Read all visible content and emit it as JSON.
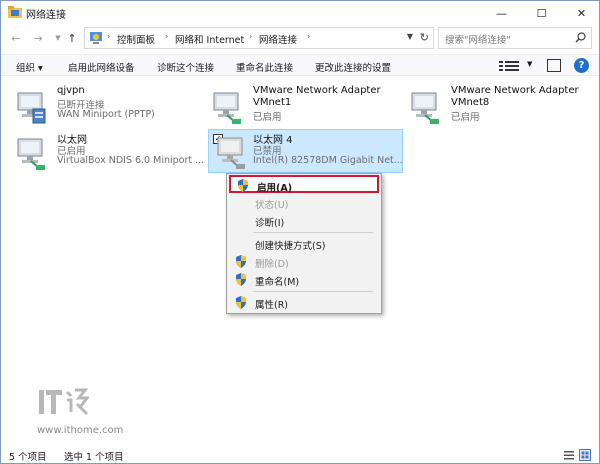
{
  "window": {
    "title": "网络连接",
    "min_glyph": "—",
    "max_glyph": "☐",
    "close_glyph": "✕"
  },
  "address": {
    "crumbs": [
      "控制面板",
      "网络和 Internet",
      "网络连接"
    ],
    "search_placeholder": "搜索\"网络连接\""
  },
  "commands": {
    "organize": "组织 ▾",
    "enable": "启用此网络设备",
    "diagnose": "诊断这个连接",
    "rename": "重命名此连接",
    "change": "更改此连接的设置",
    "help": "?"
  },
  "connections": [
    {
      "name": "qjvpn",
      "status": "已断开连接",
      "device": "WAN Miniport (PPTP)"
    },
    {
      "name": "VMware Network Adapter VMnet1",
      "name_line1": "VMware Network Adapter",
      "name_line2": "VMnet1",
      "status": "已启用",
      "device": ""
    },
    {
      "name": "VMware Network Adapter VMnet8",
      "name_line1": "VMware Network Adapter",
      "name_line2": "VMnet8",
      "status": "已启用",
      "device": ""
    },
    {
      "name": "以太网",
      "status": "已启用",
      "device": "VirtualBox NDIS 6.0 Miniport ..."
    },
    {
      "name": "以太网 4",
      "status": "已禁用",
      "device": "Intel(R) 82578DM Gigabit Net..."
    }
  ],
  "context_menu": {
    "items": [
      {
        "label": "启用(A)",
        "icon": "uac-shield-icon",
        "disabled": false,
        "bold": true,
        "highlight": true
      },
      {
        "label": "状态(U)",
        "icon": "",
        "disabled": true
      },
      {
        "label": "诊断(I)",
        "icon": "",
        "disabled": false
      },
      {
        "label": "创建快捷方式(S)",
        "icon": "",
        "disabled": false
      },
      {
        "label": "删除(D)",
        "icon": "uac-shield-icon",
        "disabled": true
      },
      {
        "label": "重命名(M)",
        "icon": "uac-shield-icon",
        "disabled": false
      },
      {
        "label": "属性(R)",
        "icon": "uac-shield-icon",
        "disabled": false
      }
    ]
  },
  "status_bar": {
    "count": "5 个项目",
    "selected": "选中 1 个项目"
  },
  "watermark": {
    "url": "www.ithome.com"
  },
  "colors": {
    "selection_bg": "#cce8ff",
    "highlight_border": "#d21a2c",
    "help_blue": "#1e6fd0"
  }
}
